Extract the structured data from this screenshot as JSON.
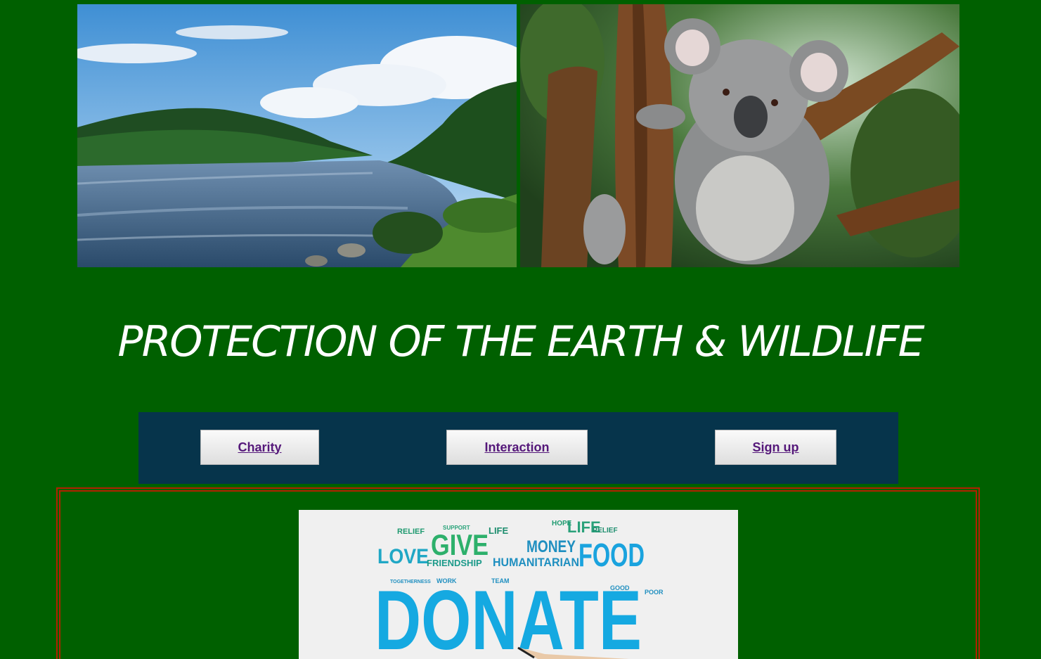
{
  "header": {
    "title": "PROTECTION OF THE EARTH & WILDLIFE"
  },
  "images": {
    "river": "river landscape photo",
    "koala": "koala on tree photo",
    "donate": "donate word cloud image"
  },
  "nav": {
    "items": [
      {
        "label": "Charity"
      },
      {
        "label": "Interaction"
      },
      {
        "label": "Sign up"
      }
    ]
  },
  "donate_words": {
    "donate": "DONATE",
    "give": "GIVE",
    "love": "LOVE",
    "money": "MONEY",
    "food": "FOOD",
    "humanitarian": "HUMANITARIAN",
    "friendship": "FRIENDSHIP",
    "life": "LIFE",
    "relief": "RELIEF",
    "support": "SUPPORT",
    "hope": "HOPE",
    "work": "WORK",
    "team": "TEAM",
    "good": "GOOD",
    "poor": "POOR",
    "togetherness": "TOGETHERNESS"
  },
  "colors": {
    "background": "#006000",
    "navbar": "#06344b",
    "link": "#55187a",
    "border": "#b22200"
  }
}
